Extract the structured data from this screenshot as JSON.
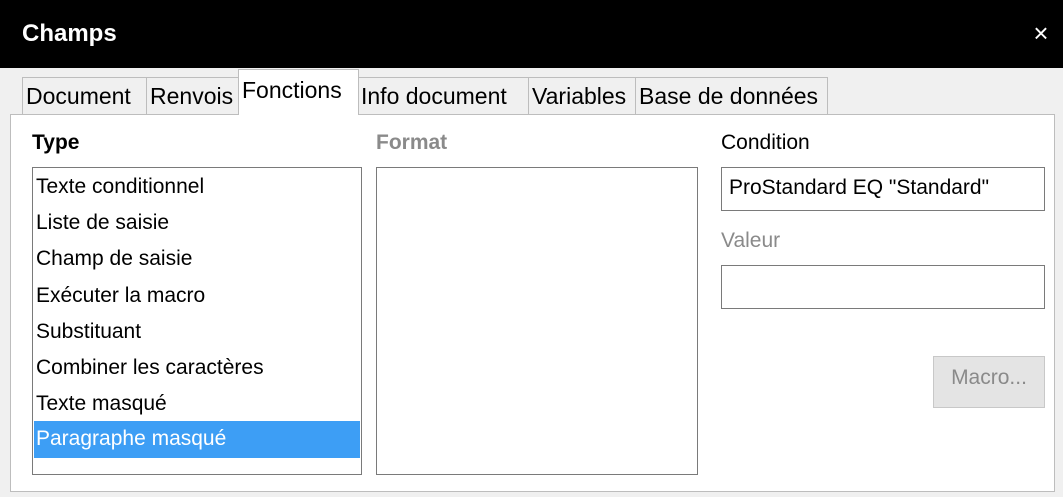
{
  "window": {
    "title": "Champs",
    "close_glyph": "×",
    "close_icon": "close-icon"
  },
  "tabs": [
    {
      "label": "Document",
      "active": false
    },
    {
      "label": "Renvois",
      "active": false
    },
    {
      "label": "Fonctions",
      "active": true
    },
    {
      "label": "Info document",
      "active": false
    },
    {
      "label": "Variables",
      "active": false
    },
    {
      "label": "Base de données",
      "active": false
    }
  ],
  "type_section": {
    "label": "Type",
    "items": [
      {
        "label": "Texte conditionnel",
        "selected": false
      },
      {
        "label": "Liste de saisie",
        "selected": false
      },
      {
        "label": "Champ de saisie",
        "selected": false
      },
      {
        "label": "Exécuter la macro",
        "selected": false
      },
      {
        "label": "Substituant",
        "selected": false
      },
      {
        "label": "Combiner les caractères",
        "selected": false
      },
      {
        "label": "Texte masqué",
        "selected": false
      },
      {
        "label": "Paragraphe masqué",
        "selected": true
      }
    ]
  },
  "format_section": {
    "label": "Format",
    "items": []
  },
  "condition": {
    "label": "Condition",
    "value": "ProStandard EQ \"Standard\""
  },
  "valeur": {
    "label": "Valeur",
    "value": ""
  },
  "macro_button": {
    "label": "Macro..."
  },
  "colors": {
    "selection": "#3d9ef5",
    "titlebar": "#000000"
  }
}
